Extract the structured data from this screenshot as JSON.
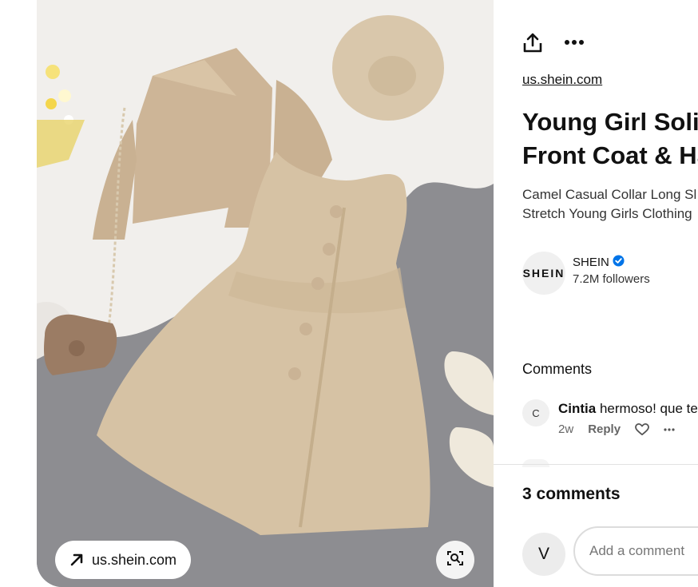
{
  "image_pane": {
    "source_chip_label": "us.shein.com",
    "source_chip_icon": "arrow-up-right-icon",
    "visual_search_icon": "visual-search-icon"
  },
  "details": {
    "toolbar": {
      "share_icon": "share-icon",
      "more_icon": "more-icon"
    },
    "source_link": "us.shein.com",
    "title_lines": [
      "Young Girl Solic",
      "Front Coat & Ha"
    ],
    "description_lines": [
      "Camel Casual Collar Long Sl",
      "Stretch Young Girls Clothing"
    ],
    "creator": {
      "avatar_text": "SHEIN",
      "name": "SHEIN",
      "verified_icon": "verified-badge-icon",
      "followers": "7.2M followers"
    },
    "comments_heading": "Comments",
    "comment": {
      "avatar_initial": "C",
      "author": "Cintia",
      "text": " hermoso! que te",
      "time": "2w",
      "reply_label": "Reply",
      "like_icon": "heart-icon",
      "more_icon": "more-icon"
    },
    "comment_count": "3 comments",
    "composer": {
      "avatar_initial": "V",
      "placeholder": "Add a comment"
    }
  },
  "colors": {
    "accent_verified": "#0074e8",
    "fabric": "#d6c2a4",
    "fur": "#f1efed",
    "carpet": "#8a8a8e"
  }
}
